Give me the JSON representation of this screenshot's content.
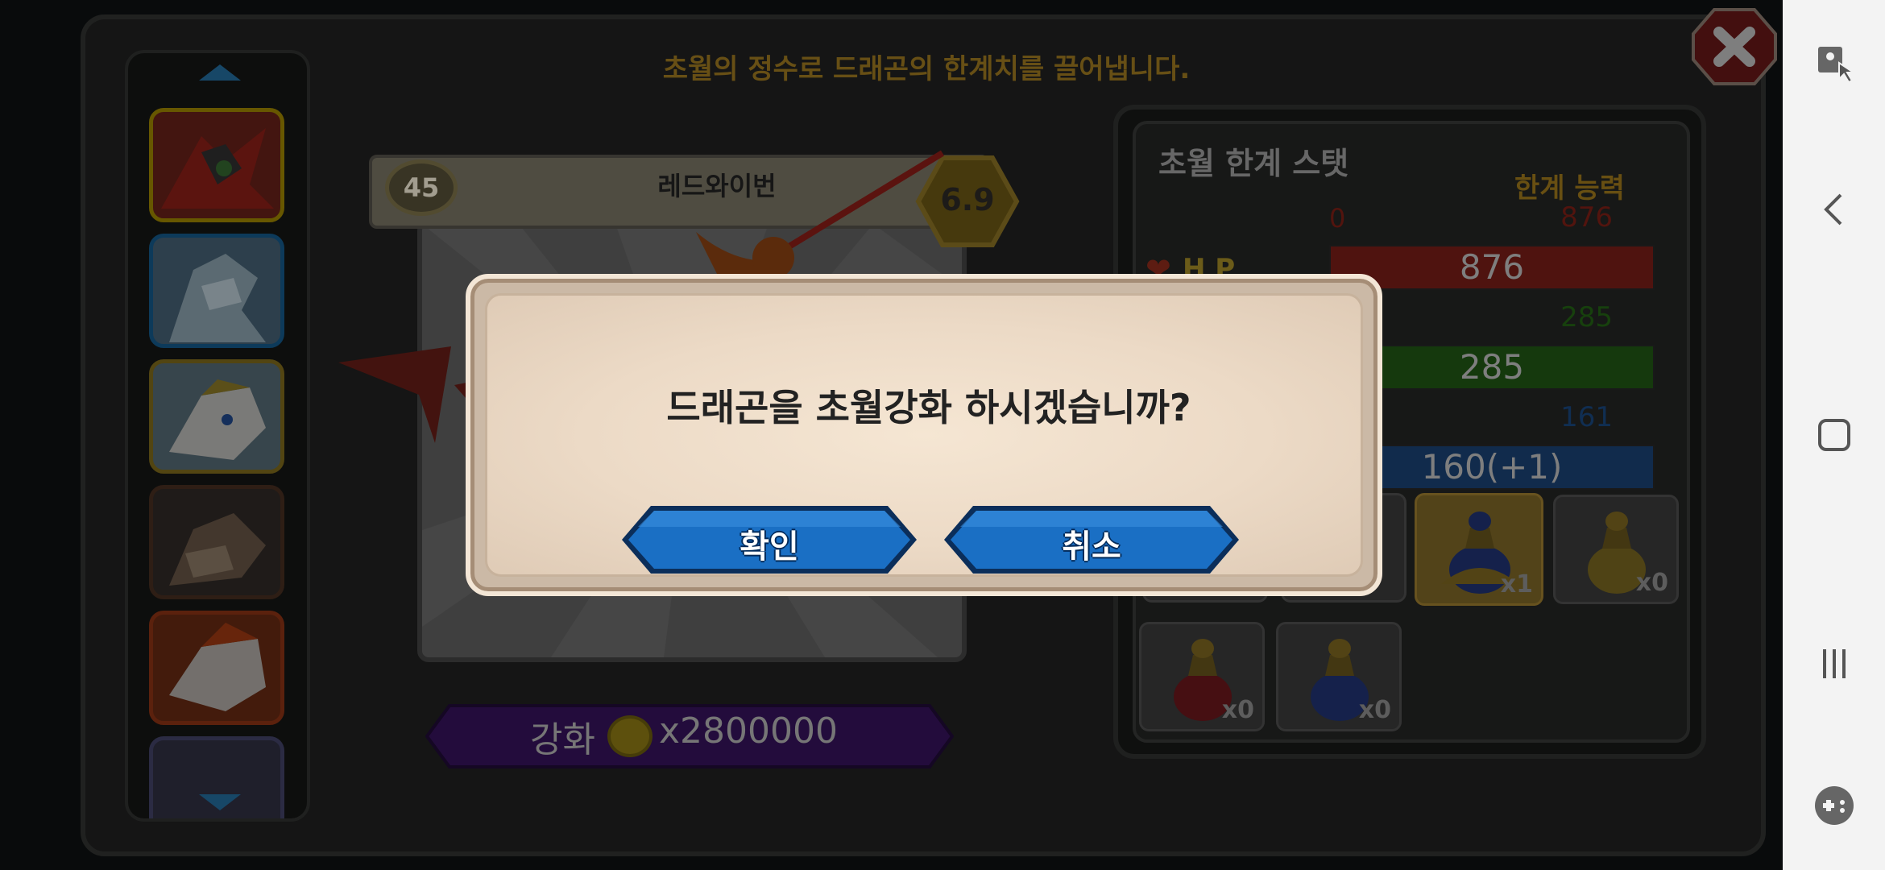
{
  "screen": {
    "subtitle": "초월의 정수로 드래곤의 한계치를 끌어냅니다."
  },
  "dragon_list": {
    "thumbnails": [
      {
        "name": "red-wyvern",
        "border": "#c9a600",
        "selected": true
      },
      {
        "name": "ice-dragon",
        "border": "#1b6fa8",
        "selected": false
      },
      {
        "name": "white-gold-dragon",
        "border": "#a48a22",
        "selected": false
      },
      {
        "name": "dark-dragon",
        "border": "#5a3a2a",
        "selected": false
      },
      {
        "name": "fire-white-dragon",
        "border": "#b2401a",
        "selected": false
      }
    ]
  },
  "dragon": {
    "level": "45",
    "name": "레드와이번",
    "grade": "6.9"
  },
  "enhance": {
    "label": "강화",
    "cost": "x2800000"
  },
  "stats": {
    "title": "초월 한계 스탯",
    "limit_header": "한계 능력",
    "hp_label": "H P",
    "rows": [
      {
        "min": "0",
        "max": "876",
        "value": "876",
        "color": "#6a1a14",
        "max_color": "#6e1b13"
      },
      {
        "max": "285",
        "value": "285",
        "color": "#1c4d12",
        "max_color": "#1f5612"
      },
      {
        "max": "161",
        "value": "160(+1)",
        "color": "#173a66",
        "max_color": "#163e6e"
      }
    ]
  },
  "items": [
    {
      "count": "",
      "type": "partial"
    },
    {
      "count": "",
      "type": "partial"
    },
    {
      "count": "x1",
      "type": "blue-potion-highlight"
    },
    {
      "count": "x0",
      "type": "gold-potion"
    },
    {
      "count": "x0",
      "type": "red-potion"
    },
    {
      "count": "x0",
      "type": "blue-potion"
    }
  ],
  "dialog": {
    "message": "드래곤을 초월강화 하시겠습니까?",
    "confirm": "확인",
    "cancel": "취소",
    "button_color": "#1a6fc4"
  },
  "nav": {
    "icons": [
      "touch-lock-icon",
      "back-icon",
      "home-icon",
      "recents-icon",
      "game-tools-icon"
    ]
  }
}
